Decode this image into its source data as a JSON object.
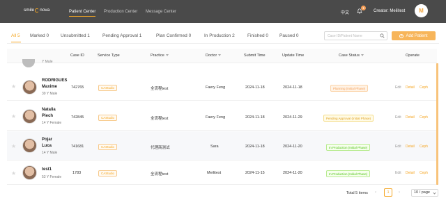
{
  "header": {
    "logo_left": "smile",
    "logo_right": "nova",
    "nav": [
      "Patient Center",
      "Production Center",
      "Message Center"
    ],
    "language": "中文",
    "notification_count": "1",
    "creator_label": "Creator: Meilitest",
    "avatar_letter": "M"
  },
  "tabs": [
    "All 5",
    "Marked 0",
    "Unsubmitted 1",
    "Pending Approval 1",
    "Plan Confirmed 0",
    "In Production 2",
    "Finished 0",
    "Paused 0"
  ],
  "search": {
    "placeholder": "Case ID/Patient Name"
  },
  "add_button": "Add Patient",
  "columns": {
    "case_id": "Case ID",
    "service_type": "Service Type",
    "practice": "Practice",
    "doctor": "Doctor",
    "submit_time": "Submit Time",
    "update_time": "Update Time",
    "case_status": "Case Status",
    "operate": "Operate"
  },
  "peek_row": {
    "text": "Y Male"
  },
  "rows": [
    {
      "name1": "RODRIGUES",
      "name2": "Maxime",
      "age": "39 Y Male",
      "case_id": "742765",
      "service": "CAStudio",
      "practice": "全流程test",
      "doctor": "Faery Feng",
      "submit": "2024-11-18",
      "update": "2024-11-18",
      "status": "Planning (Initial Phase)",
      "ops": [
        "Edit",
        "Detail",
        "Ceph"
      ]
    },
    {
      "name1": "Natalia",
      "name2": "Piech",
      "age": "14 Y Female",
      "case_id": "742845",
      "service": "CAStudio",
      "practice": "全流程test",
      "doctor": "Faery Feng",
      "submit": "2024-11-18",
      "update": "2024-11-29",
      "status": "Pending Approval (Initial Phase)",
      "ops": [
        "Edit",
        "Detail",
        "Ceph"
      ]
    },
    {
      "name1": "Pojar",
      "name2": "Luca",
      "age": "14 Y Male",
      "case_id": "741681",
      "service": "CAStudio",
      "practice": "代理商测试",
      "doctor": "Sara",
      "submit": "2024-11-18",
      "update": "2024-11-20",
      "status": "In Production (Initial Phase)",
      "ops": [
        "Edit",
        "Detail",
        "Ceph"
      ]
    },
    {
      "name1": "test1",
      "name2": "",
      "age": "53 Y Female",
      "case_id": "1783",
      "service": "CAStudio",
      "practice": "全流程test",
      "doctor": "Meilitest",
      "submit": "2024-11-15",
      "update": "2024-11-20",
      "status": "In Production (Initial Phase)",
      "ops": [
        "Edit",
        "Detail",
        "Ceph"
      ]
    }
  ],
  "pagination": {
    "total": "Total 5 items",
    "current": "1",
    "page_size": "10 / page"
  },
  "colors": {
    "accent": "#f5a623",
    "topbar": "#4a4a4a"
  }
}
